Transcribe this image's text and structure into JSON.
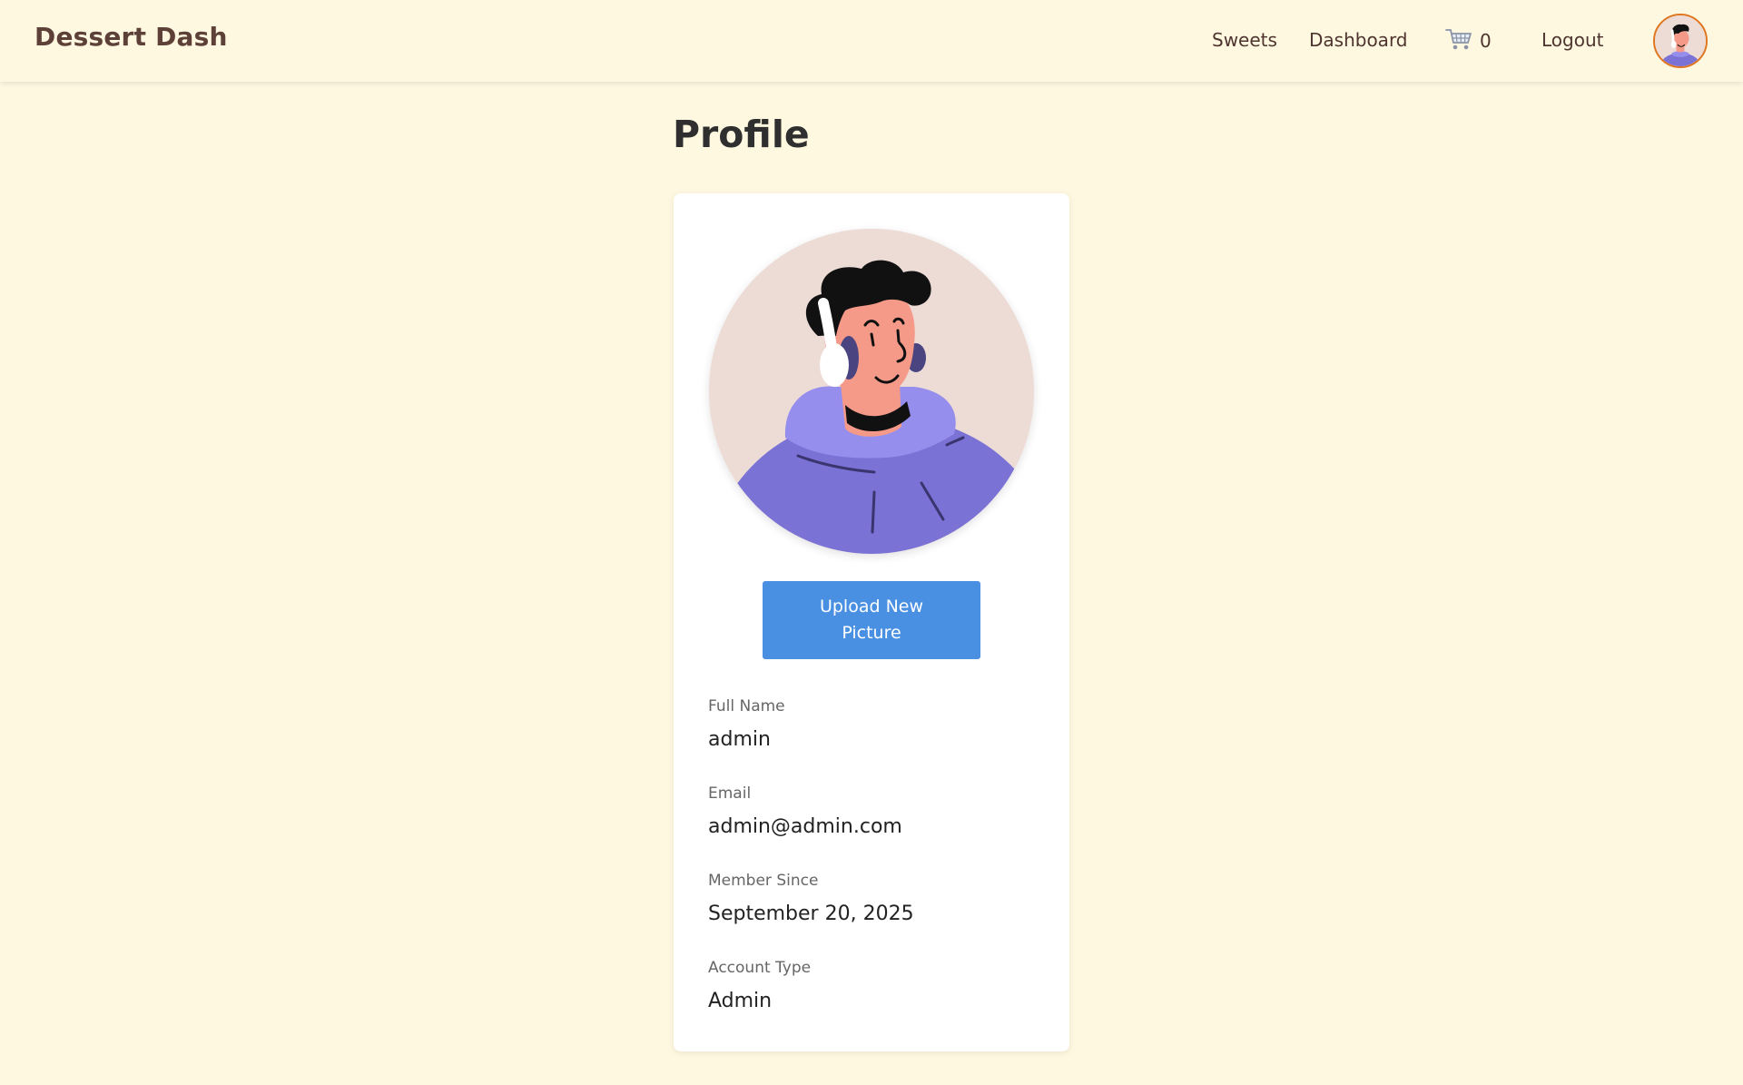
{
  "brand": {
    "name": "Dessert Dash"
  },
  "nav": {
    "sweets": "Sweets",
    "dashboard": "Dashboard",
    "cart_count": "0",
    "cart_icon": "shopping-cart-icon",
    "logout": "Logout",
    "avatar_icon": "user-avatar-icon"
  },
  "page": {
    "title": "Profile"
  },
  "profile": {
    "picture_icon": "headphones-user-avatar-icon",
    "upload_label": "Upload New Picture",
    "fields": [
      {
        "label": "Full Name",
        "value": "admin"
      },
      {
        "label": "Email",
        "value": "admin@admin.com"
      },
      {
        "label": "Member Since",
        "value": "September 20, 2025"
      },
      {
        "label": "Account Type",
        "value": "Admin"
      }
    ]
  },
  "colors": {
    "background": "#fff8e1",
    "brand": "#5d4037",
    "button": "#4a90e2",
    "avatar_border": "#e0761f",
    "avatar_bg": "#eddcd6",
    "hoodie": "#7b72d6"
  }
}
